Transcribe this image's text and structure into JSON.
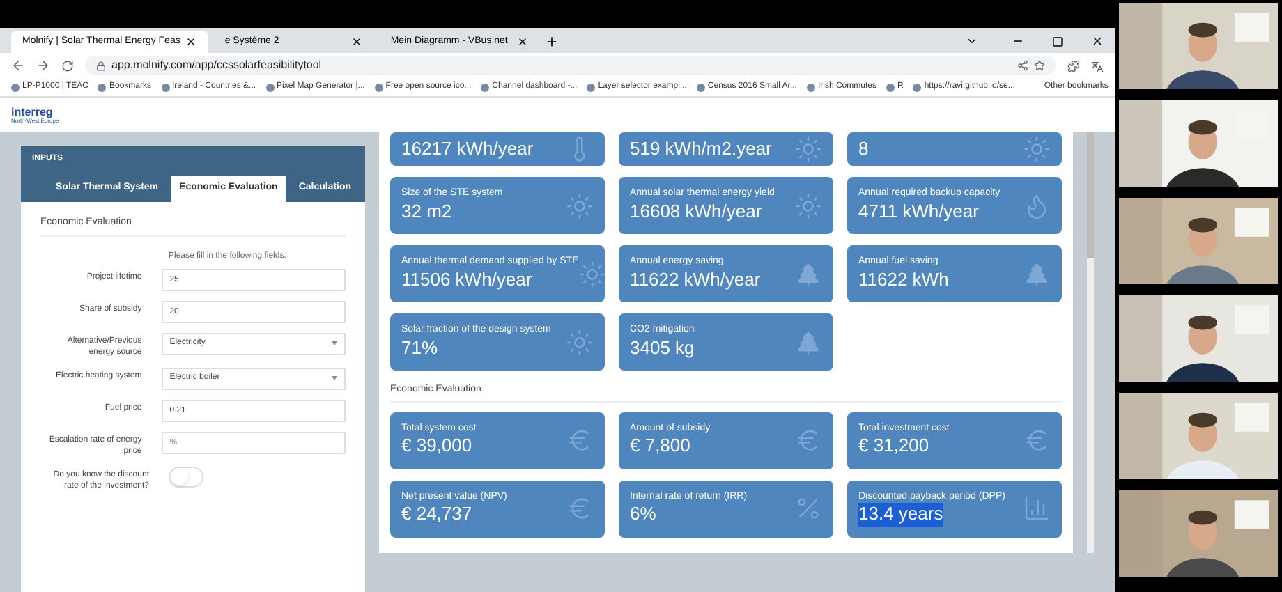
{
  "browser": {
    "tabs": [
      {
        "title": "Molnify | Solar Thermal Energy Feas",
        "selected": true
      },
      {
        "title": "e Système 2",
        "selected": false
      },
      {
        "title": "Mein Diagramm - VBus.net",
        "selected": false
      }
    ],
    "url": "app.molnify.com/app/ccssolarfeasibilitytool",
    "bookmarks": [
      "LP-P1000 | TEAC",
      "Bookmarks",
      "Ireland - Countries &...",
      "Pixel Map Generator |...",
      "Free open source ico...",
      "Channel dashboard -...",
      "Layer selector exampl...",
      "Census 2016 Small Ar...",
      "Irish Commutes",
      "R",
      "https://ravi.github.io/se..."
    ],
    "other_bookmarks": "Other bookmarks"
  },
  "header": {
    "logo": "interreg",
    "logo_subtitle": "North-West Europe"
  },
  "inputs": {
    "title": "INPUTS",
    "tabs": [
      {
        "label": "Solar Thermal System",
        "selected": false
      },
      {
        "label": "Economic Evaluation",
        "selected": true
      },
      {
        "label": "Calculation",
        "selected": false
      }
    ],
    "section": "Economic Evaluation",
    "instruction": "Please fill in the following fields:",
    "fields": [
      {
        "kind": "input",
        "label": "Project lifetime",
        "value": "25"
      },
      {
        "kind": "input",
        "label": "Share of subsidy",
        "value": "20"
      },
      {
        "kind": "select",
        "label": "Alternative/Previous energy source",
        "value": "Electricity"
      },
      {
        "kind": "select",
        "label": "Electric heating system",
        "value": "Electric boiler"
      },
      {
        "kind": "input",
        "label": "Fuel price",
        "value": "0.21"
      },
      {
        "kind": "input",
        "label": "Escalation rate of energy price",
        "placeholder": "%"
      },
      {
        "kind": "toggle",
        "label": "Do you know the discount rate of the investment?",
        "on": false
      }
    ]
  },
  "results": {
    "cards": [
      {
        "value": "16217 kWh/year",
        "kind": "thermometer"
      },
      {
        "value": "519 kWh/m2.year",
        "kind": "sun"
      },
      {
        "value": "8",
        "kind": "sun"
      },
      {
        "label": "Size of the STE system",
        "value": "32 m2",
        "kind": "sun"
      },
      {
        "label": "Annual solar thermal energy yield",
        "value": "16608 kWh/year",
        "kind": "sun"
      },
      {
        "label": "Annual required backup capacity",
        "value": "4711 kWh/year",
        "kind": "flame"
      },
      {
        "label": "Annual thermal demand supplied by STE",
        "value": "11506 kWh/year",
        "kind": "sun"
      },
      {
        "label": "Annual energy saving",
        "value": "11622 kWh/year",
        "kind": "tree"
      },
      {
        "label": "Annual fuel saving",
        "value": "11622 kWh",
        "kind": "tree"
      },
      {
        "label": "Solar fraction of the design system",
        "value": "71%",
        "kind": "sun"
      },
      {
        "label": "CO2 mitigation",
        "value": "3405 kg",
        "kind": "tree"
      }
    ],
    "economic_title": "Economic Evaluation",
    "economic_cards": [
      {
        "label": "Total system cost",
        "value": "€ 39,000",
        "kind": "euro",
        "highlighted": false
      },
      {
        "label": "Amount of subsidy",
        "value": "€ 7,800",
        "kind": "euro",
        "highlighted": false
      },
      {
        "label": "Total investment cost",
        "value": "€ 31,200",
        "kind": "euro",
        "highlighted": false
      },
      {
        "label": "Net present value (NPV)",
        "value": "€ 24,737",
        "kind": "euro",
        "highlighted": false
      },
      {
        "label": "Internal rate of return (IRR)",
        "value": "6%",
        "kind": "percent",
        "highlighted": false
      },
      {
        "label": "Discounted payback period (DPP)",
        "value": "13.4 years",
        "kind": "chart",
        "highlighted": true
      }
    ]
  }
}
